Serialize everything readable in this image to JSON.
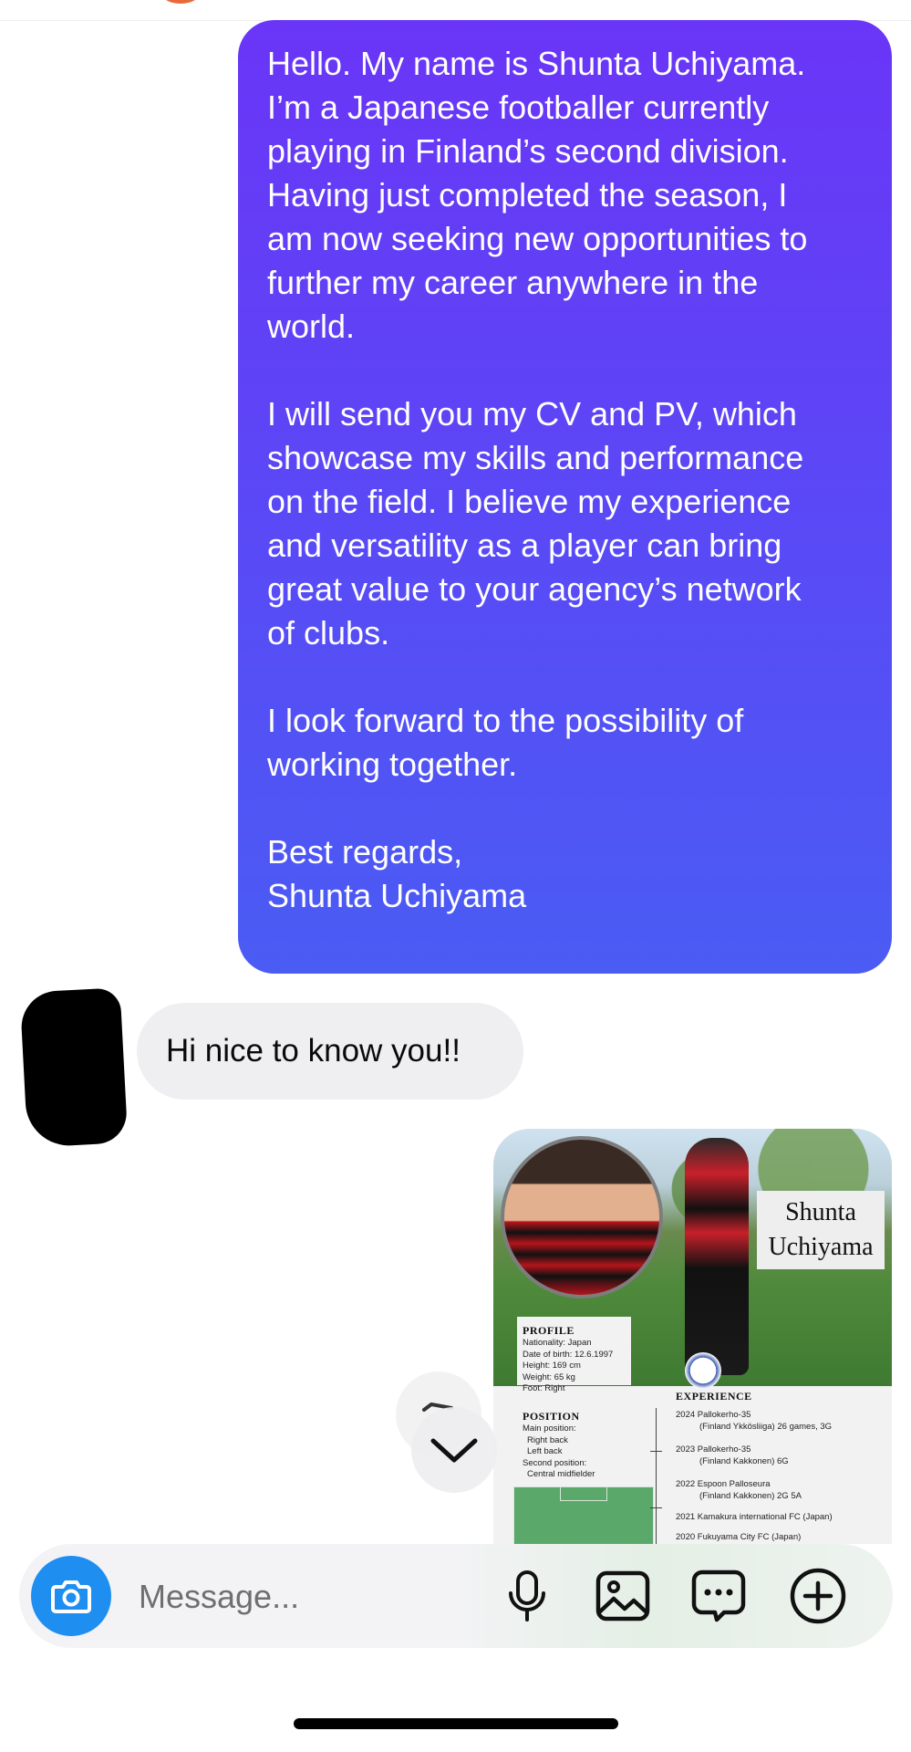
{
  "thread": {
    "outgoing_message": {
      "paragraphs": [
        "Hello. My name is Shunta Uchiyama.\nI’m a Japanese footballer currently\nplaying in Finland’s second division.\nHaving just completed the season, I\nam now seeking new opportunities to\nfurther my career anywhere in the\nworld.",
        "I will send you my CV and PV, which\nshowcase my skills and performance\non the field. I believe my experience\nand versatility as a player can bring\ngreat value to your agency’s network\nof clubs.",
        "I look forward to the possibility of\nworking together.",
        "Best regards,\nShunta Uchiyama"
      ]
    },
    "incoming_message": {
      "text": "Hi nice to know you!!"
    },
    "cv_attachment": {
      "name_line1": "Shunta",
      "name_line2": "Uchiyama",
      "profile_heading": "PROFILE",
      "profile_lines": [
        "Nationality: Japan",
        "Date of birth: 12.6.1997",
        "Height: 169 cm",
        "Weight: 65 kg",
        "Foot: Right"
      ],
      "position_heading": "POSITION",
      "position_lines": [
        "Main position:",
        "  Right back",
        "  Left back",
        "Second position:",
        "  Central midfielder"
      ],
      "experience_heading": "EXPERIENCE",
      "experience": [
        {
          "line": "2024 Pallokerho-35",
          "sub": "(Finland Ykkösliiga) 26 games, 3G"
        },
        {
          "line": "2023  Pallokerho-35",
          "sub": "(Finland Kakkonen) 6G"
        },
        {
          "line": "2022  Espoon Palloseura",
          "sub": "(Finland Kakkonen) 2G 5A"
        },
        {
          "line": "2021   Kamakura international FC (Japan)",
          "sub": ""
        },
        {
          "line": "2020  Fukuyama City FC (Japan)",
          "sub": ""
        }
      ]
    }
  },
  "composer": {
    "placeholder": "Message...",
    "icons": [
      "camera-icon",
      "microphone-icon",
      "gallery-icon",
      "sticker-icon",
      "plus-icon"
    ]
  },
  "colors": {
    "outgoing_gradient_top": "#6a35f7",
    "outgoing_gradient_bottom": "#4a5cf4",
    "camera_button": "#1f8ef1",
    "incoming_bubble": "#efeff1"
  }
}
